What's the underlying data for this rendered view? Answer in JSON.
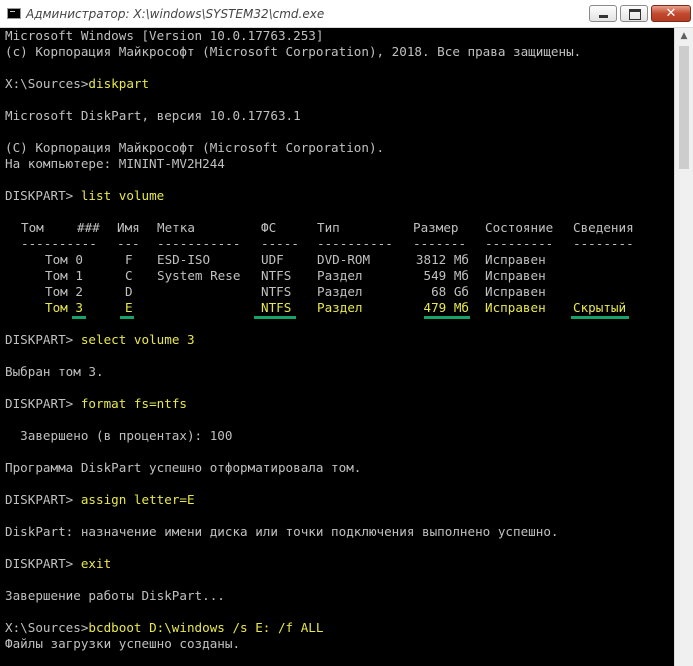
{
  "window": {
    "title": "Администратор: X:\\windows\\SYSTEM32\\cmd.exe",
    "close_glyph": "✕",
    "scroll_up_glyph": "▲"
  },
  "console": {
    "lines": [
      "Microsoft Windows [Version 10.0.17763.253]",
      "(c) Корпорация Майкрософт (Microsoft Corporation), 2018. Все права защищены.",
      "X:\\Sources>",
      "Microsoft DiskPart, версия 10.0.17763.1",
      "(C) Корпорация Майкрософт (Microsoft Corporation).",
      "На компьютере: MININT-MV2H244",
      "DISKPART> ",
      "DISKPART> ",
      "Выбран том 3.",
      "DISKPART> ",
      "  Завершено (в процентах): 100",
      "Программа DiskPart успешно отформатировала том.",
      "DISKPART> ",
      "DiskPart: назначение имени диска или точки подключения выполнено успешно.",
      "DISKPART> ",
      "Завершение работы DiskPart...",
      "X:\\Sources>",
      "Файлы загрузки успешно созданы."
    ],
    "commands": [
      "diskpart",
      "list volume",
      "select volume 3",
      "format fs=ntfs",
      "assign letter=E",
      "exit",
      "bcdboot D:\\windows /s E: /f ALL"
    ],
    "table": {
      "headers": [
        "Том",
        "###",
        "Имя",
        "Метка",
        "ФС",
        "Тип",
        "Размер",
        "Состояние",
        "Сведения"
      ],
      "separators": [
        "----------",
        "---",
        "-----------",
        "-----",
        "----------",
        "-------",
        "---------",
        "--------"
      ],
      "rows": [
        [
          "Том 0",
          "F",
          "ESD-ISO",
          "UDF",
          "DVD-ROM",
          "3812 Мб",
          "Исправен",
          ""
        ],
        [
          "Том 1",
          "C",
          "System Rese",
          "NTFS",
          "Раздел",
          "549 Мб",
          "Исправен",
          ""
        ],
        [
          "Том 2",
          "D",
          "",
          "NTFS",
          "Раздел",
          "68 Gб",
          "Исправен",
          ""
        ],
        [
          "Том 3",
          "E",
          "",
          "NTFS",
          "Раздел",
          "479 Мб",
          "Исправен",
          "Скрытый"
        ]
      ]
    }
  },
  "colors": {
    "background": "#000000",
    "text": "#c0c0c0",
    "command": "#e8e84c",
    "selected_row": "#e8e84c",
    "underline_marker": "#15a36a"
  }
}
